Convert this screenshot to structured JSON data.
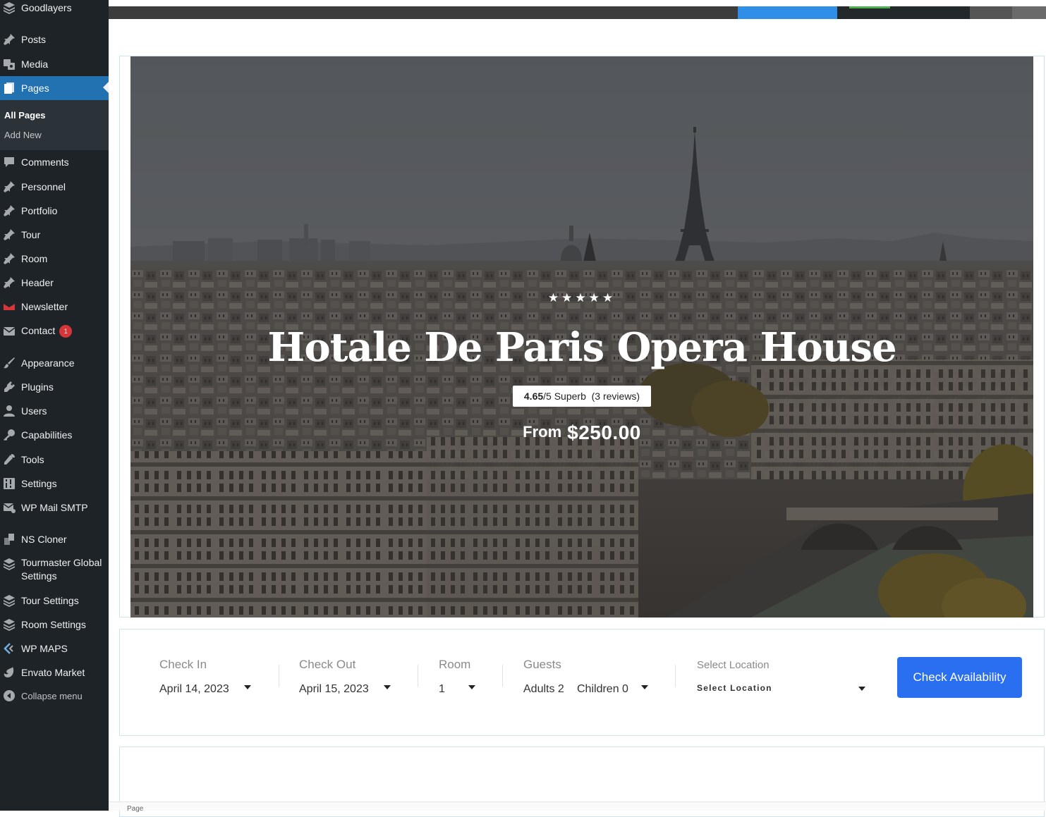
{
  "sidebar": {
    "site_name": "Goodlayers",
    "items": {
      "posts": "Posts",
      "media": "Media",
      "pages": "Pages",
      "comments": "Comments",
      "personnel": "Personnel",
      "portfolio": "Portfolio",
      "tour": "Tour",
      "room": "Room",
      "header": "Header",
      "newsletter": "Newsletter",
      "contact": "Contact",
      "appearance": "Appearance",
      "plugins": "Plugins",
      "users": "Users",
      "capabilities": "Capabilities",
      "tools": "Tools",
      "settings": "Settings",
      "wp_mail_smtp": "WP Mail SMTP",
      "ns_cloner": "NS Cloner",
      "tourmaster_global": "Tourmaster Global Settings",
      "tour_settings": "Tour Settings",
      "room_settings": "Room Settings",
      "wp_maps": "WP MAPS",
      "envato_market": "Envato Market",
      "collapse": "Collapse menu"
    },
    "submenu": {
      "all_pages": "All Pages",
      "add_new": "Add New"
    },
    "contact_badge": "1"
  },
  "hero": {
    "stars": "★★★★★",
    "title": "Hotale De Paris Opera House",
    "rating_score": "4.65",
    "rating_rest": "/5 Superb  (3 reviews)",
    "price_from": "From",
    "price_value": "$250.00"
  },
  "booking": {
    "check_in_label": "Check In",
    "check_in_value": "April 14, 2023",
    "check_out_label": "Check Out",
    "check_out_value": "April 15, 2023",
    "room_label": "Room",
    "room_value": "1",
    "guests_label": "Guests",
    "adults_value": "Adults 2",
    "children_value": "Children 0",
    "location_label": "Select Location",
    "location_value": "Select Location",
    "button_label": "Check Availability"
  },
  "footer": {
    "text": "Page"
  },
  "colors": {
    "sidebar_bg": "#1d2327",
    "active_menu": "#2271b1",
    "badge": "#d63638",
    "button": "#2a6ff0"
  }
}
